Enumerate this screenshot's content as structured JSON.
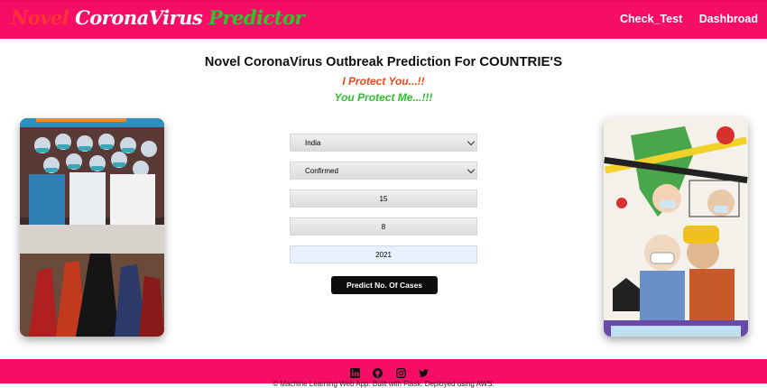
{
  "navbar": {
    "brand": {
      "word1": "Novel",
      "word2": "CoronaVirus",
      "word3": "Predictor"
    },
    "links": {
      "check_test": "Check_Test",
      "dashboard": "Dashbroad"
    },
    "colors": {
      "bar": "#f50d66",
      "brand_red": "#ff3333",
      "brand_green": "#2ec52e"
    }
  },
  "main": {
    "title": "Novel CoronaVirus Outbreak Prediction For",
    "title_caps": "COUNTRIE'S",
    "tagline1": "I Protect You...!!",
    "tagline2": "You Protect Me...!!!",
    "images": {
      "left": "healthcare-heroes-illustration",
      "right": "social-distancing-drawing"
    }
  },
  "form": {
    "country": {
      "selected": "India"
    },
    "case_type": {
      "selected": "Confirmed"
    },
    "day": {
      "value": "15"
    },
    "month": {
      "value": "8"
    },
    "year": {
      "value": "2021"
    },
    "submit_label": "Predict No. Of Cases"
  },
  "footer": {
    "icons": [
      "linkedin-icon",
      "github-icon",
      "instagram-icon",
      "twitter-icon"
    ],
    "text": "© Machine Learning Web App. Built with Flask. Deployed using AWS."
  }
}
